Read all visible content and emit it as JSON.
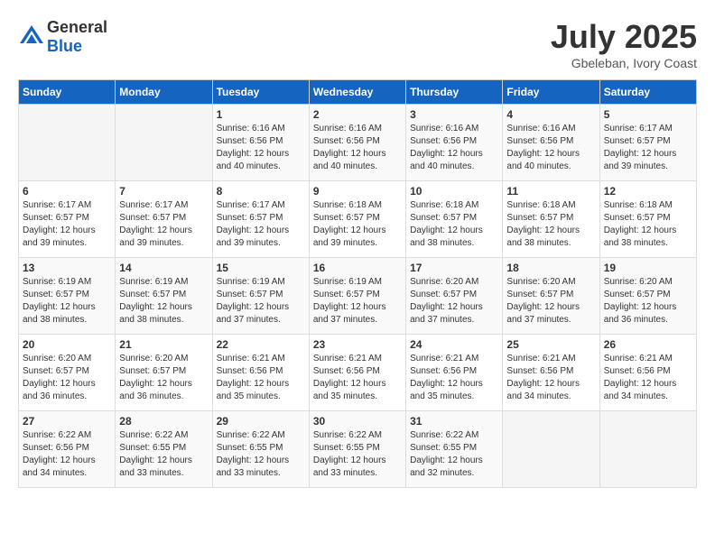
{
  "header": {
    "logo_general": "General",
    "logo_blue": "Blue",
    "month_year": "July 2025",
    "location": "Gbeleban, Ivory Coast"
  },
  "days_of_week": [
    "Sunday",
    "Monday",
    "Tuesday",
    "Wednesday",
    "Thursday",
    "Friday",
    "Saturday"
  ],
  "weeks": [
    [
      {
        "day": "",
        "info": ""
      },
      {
        "day": "",
        "info": ""
      },
      {
        "day": "1",
        "sunrise": "6:16 AM",
        "sunset": "6:56 PM",
        "daylight": "12 hours and 40 minutes."
      },
      {
        "day": "2",
        "sunrise": "6:16 AM",
        "sunset": "6:56 PM",
        "daylight": "12 hours and 40 minutes."
      },
      {
        "day": "3",
        "sunrise": "6:16 AM",
        "sunset": "6:56 PM",
        "daylight": "12 hours and 40 minutes."
      },
      {
        "day": "4",
        "sunrise": "6:16 AM",
        "sunset": "6:56 PM",
        "daylight": "12 hours and 40 minutes."
      },
      {
        "day": "5",
        "sunrise": "6:17 AM",
        "sunset": "6:57 PM",
        "daylight": "12 hours and 39 minutes."
      }
    ],
    [
      {
        "day": "6",
        "sunrise": "6:17 AM",
        "sunset": "6:57 PM",
        "daylight": "12 hours and 39 minutes."
      },
      {
        "day": "7",
        "sunrise": "6:17 AM",
        "sunset": "6:57 PM",
        "daylight": "12 hours and 39 minutes."
      },
      {
        "day": "8",
        "sunrise": "6:17 AM",
        "sunset": "6:57 PM",
        "daylight": "12 hours and 39 minutes."
      },
      {
        "day": "9",
        "sunrise": "6:18 AM",
        "sunset": "6:57 PM",
        "daylight": "12 hours and 39 minutes."
      },
      {
        "day": "10",
        "sunrise": "6:18 AM",
        "sunset": "6:57 PM",
        "daylight": "12 hours and 38 minutes."
      },
      {
        "day": "11",
        "sunrise": "6:18 AM",
        "sunset": "6:57 PM",
        "daylight": "12 hours and 38 minutes."
      },
      {
        "day": "12",
        "sunrise": "6:18 AM",
        "sunset": "6:57 PM",
        "daylight": "12 hours and 38 minutes."
      }
    ],
    [
      {
        "day": "13",
        "sunrise": "6:19 AM",
        "sunset": "6:57 PM",
        "daylight": "12 hours and 38 minutes."
      },
      {
        "day": "14",
        "sunrise": "6:19 AM",
        "sunset": "6:57 PM",
        "daylight": "12 hours and 38 minutes."
      },
      {
        "day": "15",
        "sunrise": "6:19 AM",
        "sunset": "6:57 PM",
        "daylight": "12 hours and 37 minutes."
      },
      {
        "day": "16",
        "sunrise": "6:19 AM",
        "sunset": "6:57 PM",
        "daylight": "12 hours and 37 minutes."
      },
      {
        "day": "17",
        "sunrise": "6:20 AM",
        "sunset": "6:57 PM",
        "daylight": "12 hours and 37 minutes."
      },
      {
        "day": "18",
        "sunrise": "6:20 AM",
        "sunset": "6:57 PM",
        "daylight": "12 hours and 37 minutes."
      },
      {
        "day": "19",
        "sunrise": "6:20 AM",
        "sunset": "6:57 PM",
        "daylight": "12 hours and 36 minutes."
      }
    ],
    [
      {
        "day": "20",
        "sunrise": "6:20 AM",
        "sunset": "6:57 PM",
        "daylight": "12 hours and 36 minutes."
      },
      {
        "day": "21",
        "sunrise": "6:20 AM",
        "sunset": "6:57 PM",
        "daylight": "12 hours and 36 minutes."
      },
      {
        "day": "22",
        "sunrise": "6:21 AM",
        "sunset": "6:56 PM",
        "daylight": "12 hours and 35 minutes."
      },
      {
        "day": "23",
        "sunrise": "6:21 AM",
        "sunset": "6:56 PM",
        "daylight": "12 hours and 35 minutes."
      },
      {
        "day": "24",
        "sunrise": "6:21 AM",
        "sunset": "6:56 PM",
        "daylight": "12 hours and 35 minutes."
      },
      {
        "day": "25",
        "sunrise": "6:21 AM",
        "sunset": "6:56 PM",
        "daylight": "12 hours and 34 minutes."
      },
      {
        "day": "26",
        "sunrise": "6:21 AM",
        "sunset": "6:56 PM",
        "daylight": "12 hours and 34 minutes."
      }
    ],
    [
      {
        "day": "27",
        "sunrise": "6:22 AM",
        "sunset": "6:56 PM",
        "daylight": "12 hours and 34 minutes."
      },
      {
        "day": "28",
        "sunrise": "6:22 AM",
        "sunset": "6:55 PM",
        "daylight": "12 hours and 33 minutes."
      },
      {
        "day": "29",
        "sunrise": "6:22 AM",
        "sunset": "6:55 PM",
        "daylight": "12 hours and 33 minutes."
      },
      {
        "day": "30",
        "sunrise": "6:22 AM",
        "sunset": "6:55 PM",
        "daylight": "12 hours and 33 minutes."
      },
      {
        "day": "31",
        "sunrise": "6:22 AM",
        "sunset": "6:55 PM",
        "daylight": "12 hours and 32 minutes."
      },
      {
        "day": "",
        "info": ""
      },
      {
        "day": "",
        "info": ""
      }
    ]
  ]
}
